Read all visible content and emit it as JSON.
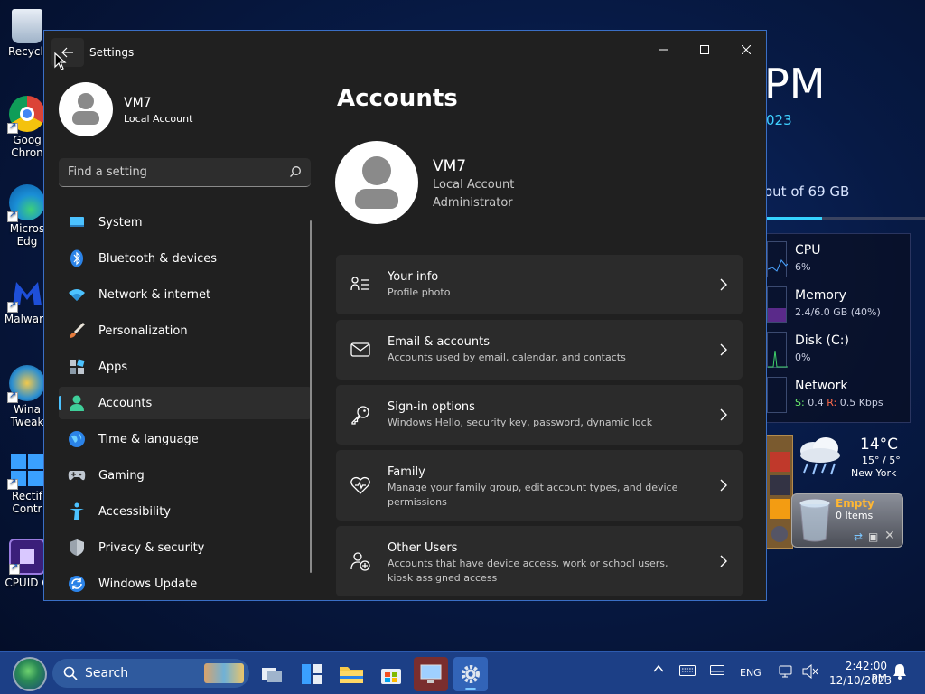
{
  "desktop": {
    "icons": [
      {
        "label": "Recycle"
      },
      {
        "label": "Goog"
      },
      {
        "label": "Chron"
      },
      {
        "label": "Micros"
      },
      {
        "label": "Edg"
      },
      {
        "label": "Malware"
      },
      {
        "label": "Wina"
      },
      {
        "label": "Tweak"
      },
      {
        "label": "Rectif"
      },
      {
        "label": "Contr"
      },
      {
        "label": "CPUID C"
      }
    ]
  },
  "widgets": {
    "clock_partial": "PM",
    "date_partial": "023",
    "disk_text": "out of 69 GB",
    "disk_fill_percent": 35,
    "meters": [
      {
        "name": "CPU",
        "value": "6%"
      },
      {
        "name": "Memory",
        "value": "2.4/6.0 GB (40%)"
      },
      {
        "name": "Disk (C:)",
        "value": "0%"
      },
      {
        "name": "Network",
        "value_s": "S:",
        "value_s_num": " 0.4 ",
        "value_r": "R:",
        "value_r_num": " 0.5 Kbps"
      }
    ],
    "weather": {
      "temp": "14°C",
      "range": "15° / 5°",
      "city": "New York"
    },
    "recycle_bin": {
      "title": "Empty",
      "items": "0 Items"
    }
  },
  "window": {
    "title": "Settings",
    "profile": {
      "name": "VM7",
      "subtitle": "Local Account"
    },
    "search": {
      "placeholder": "Find a setting"
    },
    "nav": [
      {
        "label": "System",
        "icon": "system-icon"
      },
      {
        "label": "Bluetooth & devices",
        "icon": "bluetooth-icon"
      },
      {
        "label": "Network & internet",
        "icon": "wifi-icon"
      },
      {
        "label": "Personalization",
        "icon": "brush-icon"
      },
      {
        "label": "Apps",
        "icon": "apps-icon"
      },
      {
        "label": "Accounts",
        "icon": "accounts-icon",
        "active": true
      },
      {
        "label": "Time & language",
        "icon": "globe-icon"
      },
      {
        "label": "Gaming",
        "icon": "gamepad-icon"
      },
      {
        "label": "Accessibility",
        "icon": "accessibility-icon"
      },
      {
        "label": "Privacy & security",
        "icon": "shield-icon"
      },
      {
        "label": "Windows Update",
        "icon": "update-icon"
      }
    ],
    "page": {
      "title": "Accounts",
      "account": {
        "name": "VM7",
        "type": "Local Account",
        "role": "Administrator"
      },
      "cards": [
        {
          "title": "Your info",
          "desc": "Profile photo",
          "icon": "person-card-icon"
        },
        {
          "title": "Email & accounts",
          "desc": "Accounts used by email, calendar, and contacts",
          "icon": "mail-icon"
        },
        {
          "title": "Sign-in options",
          "desc": "Windows Hello, security key, password, dynamic lock",
          "icon": "key-icon"
        },
        {
          "title": "Family",
          "desc": "Manage your family group, edit account types, and device permissions",
          "icon": "family-heart-icon"
        },
        {
          "title": "Other Users",
          "desc": "Accounts that have device access, work or school users, kiosk assigned access",
          "icon": "add-user-icon"
        }
      ]
    }
  },
  "taskbar": {
    "search_label": "Search",
    "tray": {
      "lang": "ENG",
      "time": "2:42:00 PM",
      "date": "12/10/2023"
    }
  },
  "colors": {
    "accent": "#4cc2ff",
    "window_bg": "#202020",
    "card_bg": "#2b2b2b",
    "taskbar_bg": "#1c3f86"
  }
}
